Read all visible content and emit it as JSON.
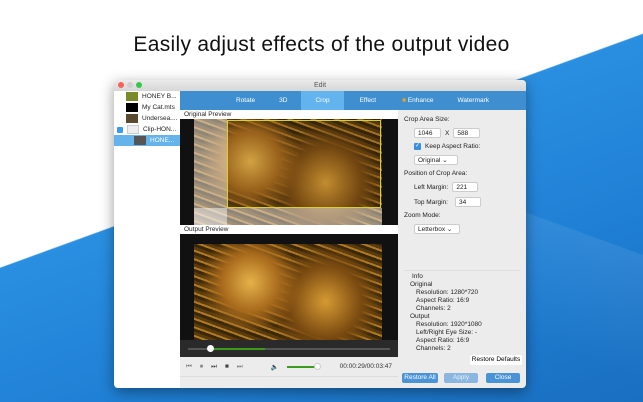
{
  "headline": "Easily adjust effects of the output video",
  "window": {
    "title": "Edit"
  },
  "files": [
    {
      "name": "HONEY B...",
      "thumb": "#7a8a2a"
    },
    {
      "name": "My Cat.mts",
      "thumb": "#000000"
    },
    {
      "name": "Undersea....",
      "thumb": "#5a4a30"
    },
    {
      "name": "Clip-HON...",
      "thumb": "#eeeeee"
    },
    {
      "name": "HONE...",
      "thumb": "#555555",
      "selected": true
    }
  ],
  "tabs": [
    {
      "label": "Rotate"
    },
    {
      "label": "3D"
    },
    {
      "label": "Crop",
      "active": true
    },
    {
      "label": "Effect"
    },
    {
      "label": "Enhance"
    },
    {
      "label": "Watermark"
    }
  ],
  "preview": {
    "original_label": "Original Preview",
    "output_label": "Output Preview",
    "time": "00:00:29/00:03:47",
    "progress": 0.13,
    "volume": 0.8
  },
  "crop": {
    "size_label": "Crop Area Size:",
    "width": "1046",
    "x": "X",
    "height": "588",
    "keep_aspect_label": "Keep Aspect Ratio:",
    "keep_aspect": true,
    "aspect_value": "Original",
    "position_label": "Position of Crop Area:",
    "left_label": "Left Margin:",
    "left": "221",
    "top_label": "Top Margin:",
    "top": "34",
    "zoom_label": "Zoom Mode:",
    "zoom_value": "Letterbox"
  },
  "info": {
    "title": "Info",
    "original_title": "Original",
    "original": [
      "Resolution: 1280*720",
      "Aspect Ratio: 16:9",
      "Channels: 2"
    ],
    "output_title": "Output",
    "output": [
      "Resolution: 1920*1080",
      "Left/Right Eye Size: -",
      "Aspect Ratio: 16:9",
      "Channels: 2"
    ]
  },
  "buttons": {
    "restore_defaults": "Restore Defaults",
    "restore_all": "Restore All",
    "apply": "Apply",
    "close": "Close"
  }
}
